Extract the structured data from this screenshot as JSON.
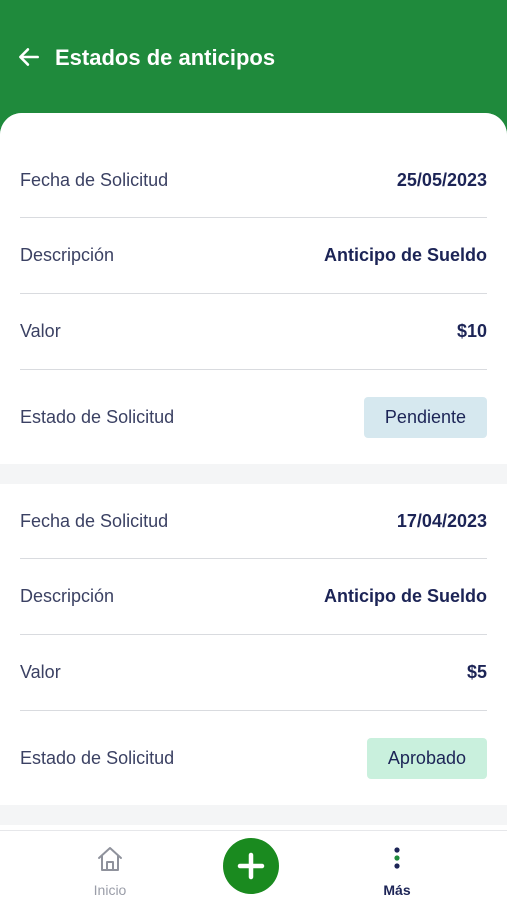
{
  "header": {
    "title": "Estados de anticipos"
  },
  "requests": [
    {
      "date_label": "Fecha de Solicitud",
      "date": "25/05/2023",
      "desc_label": "Descripción",
      "desc": "Anticipo de Sueldo",
      "value_label": "Valor",
      "value": "$10",
      "status_label": "Estado de Solicitud",
      "status": "Pendiente"
    },
    {
      "date_label": "Fecha de Solicitud",
      "date": "17/04/2023",
      "desc_label": "Descripción",
      "desc": "Anticipo de Sueldo",
      "value_label": "Valor",
      "value": "$5",
      "status_label": "Estado de Solicitud",
      "status": "Aprobado"
    }
  ],
  "nav": {
    "home_label": "Inicio",
    "more_label": "Más"
  },
  "icons": {
    "back": "arrow-left-icon",
    "home": "home-icon",
    "add": "plus-icon",
    "more": "more-vertical-icon"
  },
  "colors": {
    "primary": "#1f8a3c",
    "pending": "#d6e8ef",
    "approved": "#c9f0dd",
    "text": "#1c2456"
  }
}
